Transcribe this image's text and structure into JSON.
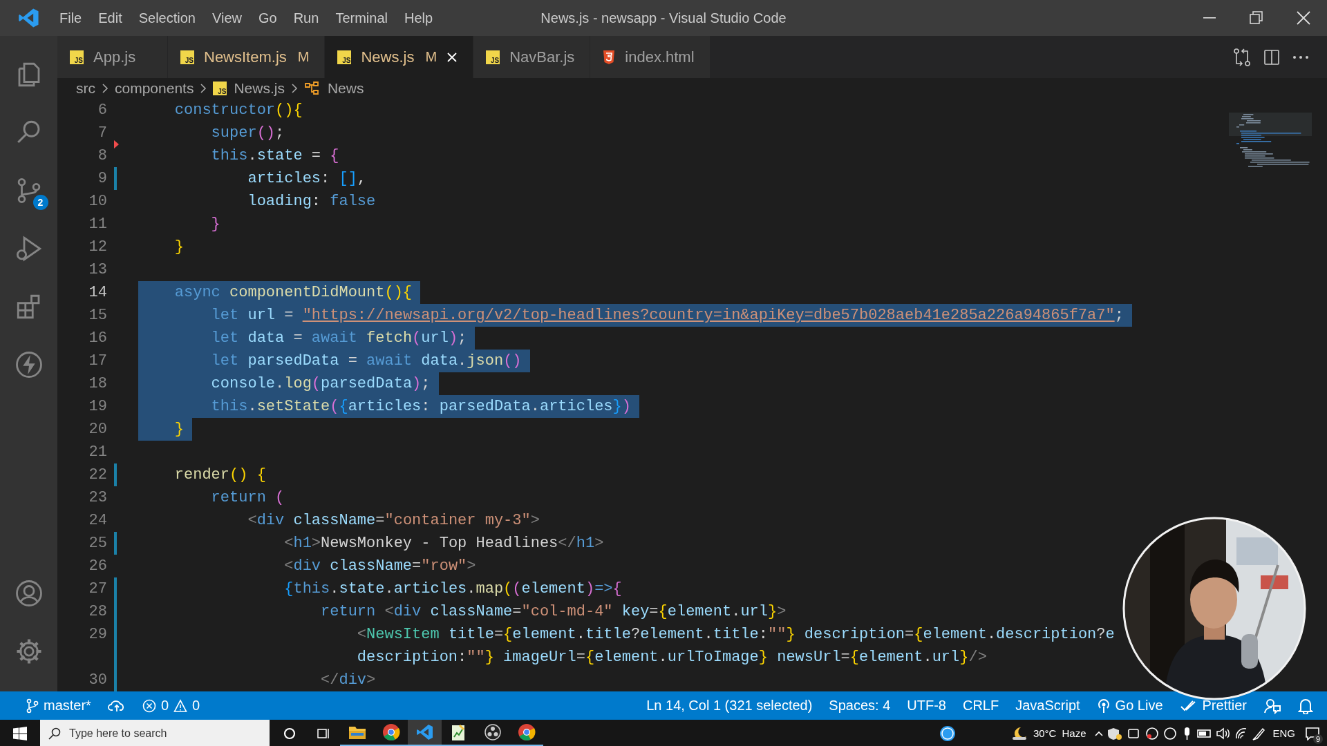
{
  "titlebar": {
    "menu": [
      "File",
      "Edit",
      "Selection",
      "View",
      "Go",
      "Run",
      "Terminal",
      "Help"
    ],
    "title": "News.js - newsapp - Visual Studio Code"
  },
  "activity": {
    "top": [
      {
        "kind": "explorer"
      },
      {
        "kind": "search"
      },
      {
        "kind": "source-control",
        "badge": "2"
      },
      {
        "kind": "run"
      },
      {
        "kind": "extensions"
      },
      {
        "kind": "bolt"
      }
    ],
    "bottom": [
      {
        "kind": "account"
      },
      {
        "kind": "settings"
      }
    ]
  },
  "tabs": [
    {
      "label": "App.js",
      "kind": "js",
      "icon_label": "JS",
      "modified": false,
      "selected": false
    },
    {
      "label": "NewsItem.js",
      "kind": "js",
      "icon_label": "JS",
      "modified": true,
      "mark": "M",
      "selected": false
    },
    {
      "label": "News.js",
      "kind": "js",
      "icon_label": "JS",
      "modified": true,
      "mark": "M",
      "selected": true
    },
    {
      "label": "NavBar.js",
      "kind": "js",
      "icon_label": "JS",
      "modified": false,
      "selected": false
    },
    {
      "label": "index.html",
      "kind": "html",
      "modified": false,
      "selected": false
    }
  ],
  "breadcrumb": [
    {
      "label": "src",
      "kind": "folder"
    },
    {
      "label": "components",
      "kind": "folder"
    },
    {
      "label": "News.js",
      "kind": "js",
      "icon_label": "JS"
    },
    {
      "label": "News",
      "kind": "class"
    }
  ],
  "editor": {
    "lines": [
      {
        "number": "6",
        "modified": false,
        "deleted": false,
        "selected": false,
        "current": false,
        "tokens": [
          {
            "kind": "kw",
            "text": "    constructor"
          },
          {
            "kind": "b1",
            "text": "(){"
          }
        ]
      },
      {
        "number": "7",
        "modified": false,
        "deleted": true,
        "selected": false,
        "current": false,
        "tokens": [
          {
            "kind": "kw",
            "text": "        super"
          },
          {
            "kind": "b2",
            "text": "()"
          },
          {
            "kind": "p",
            "text": ";"
          }
        ]
      },
      {
        "number": "8",
        "modified": false,
        "deleted": false,
        "selected": false,
        "current": false,
        "tokens": [
          {
            "kind": "kw",
            "text": "        this"
          },
          {
            "kind": "p",
            "text": "."
          },
          {
            "kind": "var",
            "text": "state"
          },
          {
            "kind": "p",
            "text": " = "
          },
          {
            "kind": "b2",
            "text": "{"
          }
        ]
      },
      {
        "number": "9",
        "modified": true,
        "deleted": false,
        "selected": false,
        "current": false,
        "tokens": [
          {
            "kind": "var",
            "text": "            articles"
          },
          {
            "kind": "p",
            "text": ": "
          },
          {
            "kind": "b3",
            "text": "[]"
          },
          {
            "kind": "p",
            "text": ","
          }
        ]
      },
      {
        "number": "10",
        "modified": false,
        "deleted": false,
        "selected": false,
        "current": false,
        "tokens": [
          {
            "kind": "var",
            "text": "            loading"
          },
          {
            "kind": "p",
            "text": ": "
          },
          {
            "kind": "kw",
            "text": "false"
          }
        ]
      },
      {
        "number": "11",
        "modified": false,
        "deleted": false,
        "selected": false,
        "current": false,
        "tokens": [
          {
            "kind": "b2",
            "text": "        }"
          }
        ]
      },
      {
        "number": "12",
        "modified": false,
        "deleted": false,
        "selected": false,
        "current": false,
        "tokens": [
          {
            "kind": "b1",
            "text": "    }"
          }
        ]
      },
      {
        "number": "13",
        "modified": false,
        "deleted": false,
        "current": false
      },
      {
        "number": "14",
        "modified": false,
        "deleted": false,
        "selected": true,
        "current": true,
        "tokens": [
          {
            "kind": "kw",
            "text": "    async "
          },
          {
            "kind": "fn",
            "text": "componentDidMount"
          },
          {
            "kind": "b1",
            "text": "(){"
          }
        ]
      },
      {
        "number": "15",
        "modified": false,
        "deleted": false,
        "selected": true,
        "current": false,
        "tokens": [
          {
            "kind": "kw",
            "text": "        let "
          },
          {
            "kind": "var",
            "text": "url"
          },
          {
            "kind": "p",
            "text": " = "
          },
          {
            "kind": "url",
            "text": "\"https://newsapi.org/v2/top-headlines?country=in&apiKey=dbe57b028aeb41e285a226a94865f7a7\""
          },
          {
            "kind": "p",
            "text": ";"
          }
        ]
      },
      {
        "number": "16",
        "modified": false,
        "deleted": false,
        "selected": true,
        "current": false,
        "tokens": [
          {
            "kind": "kw",
            "text": "        let "
          },
          {
            "kind": "var",
            "text": "data"
          },
          {
            "kind": "p",
            "text": " = "
          },
          {
            "kind": "kw",
            "text": "await "
          },
          {
            "kind": "fn",
            "text": "fetch"
          },
          {
            "kind": "b2",
            "text": "("
          },
          {
            "kind": "var",
            "text": "url"
          },
          {
            "kind": "b2",
            "text": ")"
          },
          {
            "kind": "p",
            "text": ";"
          }
        ]
      },
      {
        "number": "17",
        "modified": false,
        "deleted": false,
        "selected": true,
        "current": false,
        "tokens": [
          {
            "kind": "kw",
            "text": "        let "
          },
          {
            "kind": "var",
            "text": "parsedData"
          },
          {
            "kind": "p",
            "text": " = "
          },
          {
            "kind": "kw",
            "text": "await "
          },
          {
            "kind": "var",
            "text": "data"
          },
          {
            "kind": "p",
            "text": "."
          },
          {
            "kind": "fn",
            "text": "json"
          },
          {
            "kind": "b2",
            "text": "()"
          }
        ]
      },
      {
        "number": "18",
        "modified": false,
        "deleted": false,
        "selected": true,
        "current": false,
        "tokens": [
          {
            "kind": "var",
            "text": "        console"
          },
          {
            "kind": "p",
            "text": "."
          },
          {
            "kind": "fn",
            "text": "log"
          },
          {
            "kind": "b2",
            "text": "("
          },
          {
            "kind": "var",
            "text": "parsedData"
          },
          {
            "kind": "b2",
            "text": ")"
          },
          {
            "kind": "p",
            "text": ";"
          }
        ]
      },
      {
        "number": "19",
        "modified": false,
        "deleted": false,
        "selected": true,
        "current": false,
        "tokens": [
          {
            "kind": "kw",
            "text": "        this"
          },
          {
            "kind": "p",
            "text": "."
          },
          {
            "kind": "fn",
            "text": "setState"
          },
          {
            "kind": "b2",
            "text": "("
          },
          {
            "kind": "b3",
            "text": "{"
          },
          {
            "kind": "var",
            "text": "articles"
          },
          {
            "kind": "p",
            "text": ": "
          },
          {
            "kind": "var",
            "text": "parsedData"
          },
          {
            "kind": "p",
            "text": "."
          },
          {
            "kind": "var",
            "text": "articles"
          },
          {
            "kind": "b3",
            "text": "}"
          },
          {
            "kind": "b2",
            "text": ")"
          }
        ]
      },
      {
        "number": "20",
        "modified": false,
        "deleted": false,
        "selected": true,
        "current": false,
        "tokens": [
          {
            "kind": "b1",
            "text": "    }"
          }
        ]
      },
      {
        "number": "21",
        "modified": false,
        "deleted": false,
        "current": false
      },
      {
        "number": "22",
        "modified": true,
        "deleted": false,
        "selected": false,
        "current": false,
        "tokens": [
          {
            "kind": "fn",
            "text": "    render"
          },
          {
            "kind": "b1",
            "text": "() {"
          }
        ]
      },
      {
        "number": "23",
        "modified": false,
        "deleted": false,
        "selected": false,
        "current": false,
        "tokens": [
          {
            "kind": "kw",
            "text": "        return "
          },
          {
            "kind": "b2",
            "text": "("
          }
        ]
      },
      {
        "number": "24",
        "modified": false,
        "deleted": false,
        "selected": false,
        "current": false,
        "tokens": [
          {
            "kind": "tp",
            "text": "            <"
          },
          {
            "kind": "tag",
            "text": "div "
          },
          {
            "kind": "attr",
            "text": "className"
          },
          {
            "kind": "p",
            "text": "="
          },
          {
            "kind": "str",
            "text": "\"container my-3\""
          },
          {
            "kind": "tp",
            "text": ">"
          }
        ]
      },
      {
        "number": "25",
        "modified": true,
        "deleted": false,
        "selected": false,
        "current": false,
        "tokens": [
          {
            "kind": "tp",
            "text": "                <"
          },
          {
            "kind": "tag",
            "text": "h1"
          },
          {
            "kind": "tp",
            "text": ">"
          },
          {
            "kind": "p",
            "text": "NewsMonkey - Top Headlines"
          },
          {
            "kind": "tp",
            "text": "</"
          },
          {
            "kind": "tag",
            "text": "h1"
          },
          {
            "kind": "tp",
            "text": ">"
          }
        ]
      },
      {
        "number": "26",
        "modified": false,
        "deleted": false,
        "selected": false,
        "current": false,
        "tokens": [
          {
            "kind": "tp",
            "text": "                <"
          },
          {
            "kind": "tag",
            "text": "div "
          },
          {
            "kind": "attr",
            "text": "className"
          },
          {
            "kind": "p",
            "text": "="
          },
          {
            "kind": "str",
            "text": "\"row\""
          },
          {
            "kind": "tp",
            "text": ">"
          }
        ]
      },
      {
        "number": "27",
        "modified": true,
        "deleted": false,
        "selected": false,
        "current": false,
        "tokens": [
          {
            "kind": "b3",
            "text": "                {"
          },
          {
            "kind": "kw",
            "text": "this"
          },
          {
            "kind": "p",
            "text": "."
          },
          {
            "kind": "var",
            "text": "state"
          },
          {
            "kind": "p",
            "text": "."
          },
          {
            "kind": "var",
            "text": "articles"
          },
          {
            "kind": "p",
            "text": "."
          },
          {
            "kind": "fn",
            "text": "map"
          },
          {
            "kind": "b1",
            "text": "("
          },
          {
            "kind": "b2",
            "text": "("
          },
          {
            "kind": "var",
            "text": "element"
          },
          {
            "kind": "b2",
            "text": ")"
          },
          {
            "kind": "kw",
            "text": "=>"
          },
          {
            "kind": "b2",
            "text": "{"
          }
        ]
      },
      {
        "number": "28",
        "modified": true,
        "deleted": false,
        "selected": false,
        "current": false,
        "tokens": [
          {
            "kind": "kw",
            "text": "                    return "
          },
          {
            "kind": "tp",
            "text": "<"
          },
          {
            "kind": "tag",
            "text": "div "
          },
          {
            "kind": "attr",
            "text": "className"
          },
          {
            "kind": "p",
            "text": "="
          },
          {
            "kind": "str",
            "text": "\"col-md-4\" "
          },
          {
            "kind": "attr",
            "text": "key"
          },
          {
            "kind": "p",
            "text": "="
          },
          {
            "kind": "b1",
            "text": "{"
          },
          {
            "kind": "var",
            "text": "element"
          },
          {
            "kind": "p",
            "text": "."
          },
          {
            "kind": "var",
            "text": "url"
          },
          {
            "kind": "b1",
            "text": "}"
          },
          {
            "kind": "tp",
            "text": ">"
          }
        ]
      },
      {
        "number": "29",
        "modified": true,
        "deleted": false,
        "selected": false,
        "current": false,
        "tokens": [
          {
            "kind": "tp",
            "text": "                        <"
          },
          {
            "kind": "comp",
            "text": "NewsItem "
          },
          {
            "kind": "attr",
            "text": "title"
          },
          {
            "kind": "p",
            "text": "="
          },
          {
            "kind": "b1",
            "text": "{"
          },
          {
            "kind": "var",
            "text": "element"
          },
          {
            "kind": "p",
            "text": "."
          },
          {
            "kind": "var",
            "text": "title"
          },
          {
            "kind": "p",
            "text": "?"
          },
          {
            "kind": "var",
            "text": "element"
          },
          {
            "kind": "p",
            "text": "."
          },
          {
            "kind": "var",
            "text": "title"
          },
          {
            "kind": "p",
            "text": ":"
          },
          {
            "kind": "str",
            "text": "\"\""
          },
          {
            "kind": "b1",
            "text": "} "
          },
          {
            "kind": "attr",
            "text": "description"
          },
          {
            "kind": "p",
            "text": "="
          },
          {
            "kind": "b1",
            "text": "{"
          },
          {
            "kind": "var",
            "text": "element"
          },
          {
            "kind": "p",
            "text": "."
          },
          {
            "kind": "var",
            "text": "description"
          },
          {
            "kind": "p",
            "text": "?"
          },
          {
            "kind": "var",
            "text": "e"
          }
        ]
      },
      {
        "modified": true,
        "deleted": false,
        "selected": false,
        "tokens": [
          {
            "kind": "var",
            "text": "                        description"
          },
          {
            "kind": "p",
            "text": ":"
          },
          {
            "kind": "str",
            "text": "\"\""
          },
          {
            "kind": "b1",
            "text": "} "
          },
          {
            "kind": "attr",
            "text": "imageUrl"
          },
          {
            "kind": "p",
            "text": "="
          },
          {
            "kind": "b1",
            "text": "{"
          },
          {
            "kind": "var",
            "text": "element"
          },
          {
            "kind": "p",
            "text": "."
          },
          {
            "kind": "var",
            "text": "urlToImage"
          },
          {
            "kind": "b1",
            "text": "} "
          },
          {
            "kind": "attr",
            "text": "newsUrl"
          },
          {
            "kind": "p",
            "text": "="
          },
          {
            "kind": "b1",
            "text": "{"
          },
          {
            "kind": "var",
            "text": "element"
          },
          {
            "kind": "p",
            "text": "."
          },
          {
            "kind": "var",
            "text": "url"
          },
          {
            "kind": "b1",
            "text": "}"
          },
          {
            "kind": "tp",
            "text": "/>"
          }
        ]
      },
      {
        "number": "30",
        "modified": true,
        "deleted": false,
        "selected": false,
        "current": false,
        "tokens": [
          {
            "kind": "tp",
            "text": "                    </"
          },
          {
            "kind": "tag",
            "text": "div"
          },
          {
            "kind": "tp",
            "text": ">"
          }
        ]
      }
    ]
  },
  "status_bar": {
    "branch": "master*",
    "errors": "0",
    "warnings": "0",
    "right": [
      {
        "kind": "text",
        "label": "Ln 14, Col 1 (321 selected)"
      },
      {
        "kind": "text",
        "label": "Spaces: 4"
      },
      {
        "kind": "text",
        "label": "UTF-8"
      },
      {
        "kind": "text",
        "label": "CRLF"
      },
      {
        "kind": "text",
        "label": "JavaScript"
      },
      {
        "kind": "golive",
        "label": "Go Live"
      },
      {
        "kind": "prettier",
        "label": "Prettier"
      },
      {
        "kind": "feedback"
      },
      {
        "kind": "bell"
      }
    ]
  },
  "taskbar": {
    "search": {
      "placeholder": "Type here to search"
    },
    "apps": [
      {
        "kind": "cortana",
        "selected": false,
        "running": false
      },
      {
        "kind": "taskview",
        "selected": false,
        "running": false
      },
      {
        "kind": "explorer",
        "selected": false,
        "running": true
      },
      {
        "kind": "chrome",
        "selected": false,
        "running": true
      },
      {
        "kind": "vscode",
        "selected": true,
        "running": true
      },
      {
        "kind": "notes",
        "selected": false,
        "running": true
      },
      {
        "kind": "obs",
        "selected": false,
        "running": true
      },
      {
        "kind": "chrome",
        "selected": false,
        "running": true
      }
    ],
    "weather": {
      "temp": "30°C",
      "condition": "Haze"
    },
    "language": "ENG",
    "notification_count": "9"
  }
}
